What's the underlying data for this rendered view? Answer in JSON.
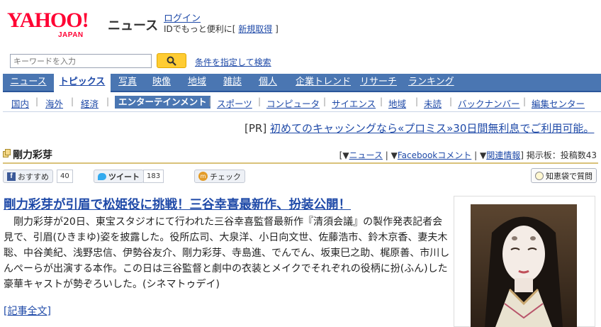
{
  "header": {
    "logo_text": "YAHOO!",
    "logo_sub": "JAPAN",
    "section_title": "ニュース",
    "login_label": "ログイン",
    "login_note_prefix": "IDでもっと便利に[",
    "signup_label": "新規取得",
    "login_note_suffix": "]"
  },
  "search": {
    "placeholder": "キーワードを入力",
    "advanced_label": "条件を指定して検索"
  },
  "main_nav": [
    {
      "label": "ニュース"
    },
    {
      "label": "トピックス",
      "active": true
    },
    {
      "label": "写真"
    },
    {
      "label": "映像"
    },
    {
      "label": "地域"
    },
    {
      "label": "雑誌"
    },
    {
      "label": "個人"
    },
    {
      "label": "企業トレンド"
    },
    {
      "label": "リサーチ"
    },
    {
      "label": "ランキング"
    }
  ],
  "sub_nav": [
    {
      "label": "国内"
    },
    {
      "label": "海外"
    },
    {
      "label": "経済"
    },
    {
      "label": "エンターテインメント",
      "active": true
    },
    {
      "label": "スポーツ"
    },
    {
      "label": "コンピュータ"
    },
    {
      "label": "サイエンス"
    },
    {
      "label": "地域"
    },
    {
      "label": "未読"
    },
    {
      "label": "バックナンバー"
    },
    {
      "label": "編集センター"
    }
  ],
  "pr": {
    "tag": "[PR]",
    "text": "初めてのキャッシングなら«プロミス»30日間無利息でご利用可能。"
  },
  "topic": {
    "name": "剛力彩芽",
    "link_news": "ニュース",
    "link_facebook": "Facebookコメント",
    "link_related": "関連情報",
    "board_label": "掲示板：投稿数43"
  },
  "social": {
    "facebook_label": "おすすめ",
    "facebook_count": "40",
    "tweet_label": "ツイート",
    "tweet_count": "183",
    "mixi_label": "チェック",
    "chiebukuro_label": "知恵袋で質問"
  },
  "article": {
    "headline": "剛力彩芽が引眉で松姫役に挑戦！三谷幸喜最新作、扮装公開！",
    "body": "　剛力彩芽が20日、東宝スタジオにて行われた三谷幸喜監督最新作『清須会議』の製作発表記者会見で、引眉(ひきまゆ)姿を披露した。役所広司、大泉洋、小日向文世、佐藤浩市、鈴木京香、妻夫木聡、中谷美紀、浅野忠信、伊勢谷友介、剛力彩芽、寺島進、でんでん、坂東巳之助、梶原善、市川しんぺーらが出演する本作。この日は三谷監督と劇中の衣装とメイクでそれぞれの役柄に扮(ふん)した豪華キャストが勢ぞろいした。(シネマトゥデイ)",
    "fulltext_label": "[記事全文]"
  },
  "colors": {
    "nav_bg": "#4a76b2",
    "link": "#1f4aa8",
    "logo_red": "#ff0033",
    "search_button": "#ffcc33"
  }
}
